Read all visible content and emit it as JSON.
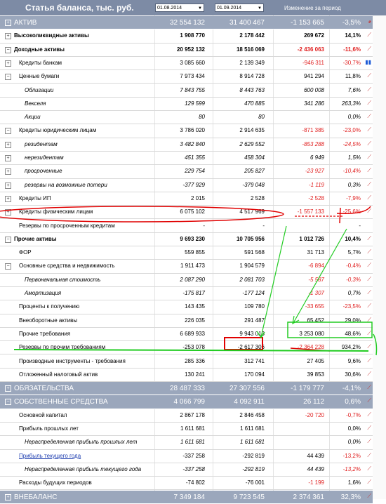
{
  "header": {
    "title": "Статья баланса, тыс. руб.",
    "date1": "01.08.2014",
    "date2": "01.09.2014",
    "change": "Изменение за период"
  },
  "rows": [
    {
      "label": "АКТИВ",
      "v1": "32 554 132",
      "v2": "31 400 467",
      "v3": "-1 153 665",
      "v4": "-3,5%",
      "style": "band",
      "exp": "+",
      "icon": "pie",
      "indent": 0
    },
    {
      "label": "Высоколиквидные активы",
      "v1": "1 908 770",
      "v2": "2 178 442",
      "v3": "269 672",
      "v4": "14,1%",
      "style": "bold",
      "exp": "+",
      "icon": "trend",
      "indent": 0
    },
    {
      "label": "Доходные активы",
      "v1": "20 952 132",
      "v2": "18 516 069",
      "v3": "-2 436 063",
      "v4": "-11,6%",
      "style": "bold",
      "exp": "-",
      "icon": "trend",
      "indent": 0
    },
    {
      "label": "Кредиты банкам",
      "v1": "3 085 660",
      "v2": "2 139 349",
      "v3": "-946 311",
      "v4": "-30,7%",
      "style": "",
      "exp": "+",
      "icon": "bars",
      "indent": 1
    },
    {
      "label": "Ценные бумаги",
      "v1": "7 973 434",
      "v2": "8 914 728",
      "v3": "941 294",
      "v4": "11,8%",
      "style": "",
      "exp": "-",
      "icon": "trend",
      "indent": 1
    },
    {
      "label": "Облигации",
      "v1": "7 843 755",
      "v2": "8 443 763",
      "v3": "600 008",
      "v4": "7,6%",
      "style": "italic",
      "exp": "",
      "icon": "trend",
      "indent": 2
    },
    {
      "label": "Векселя",
      "v1": "129 599",
      "v2": "470 885",
      "v3": "341 286",
      "v4": "263,3%",
      "style": "italic",
      "exp": "",
      "icon": "trend",
      "indent": 2
    },
    {
      "label": "Акции",
      "v1": "80",
      "v2": "80",
      "v3": "",
      "v4": "0,0%",
      "style": "italic",
      "exp": "",
      "icon": "trend",
      "indent": 2
    },
    {
      "label": "Кредиты юридическим лицам",
      "v1": "3 786 020",
      "v2": "2 914 635",
      "v3": "-871 385",
      "v4": "-23,0%",
      "style": "",
      "exp": "-",
      "icon": "trend",
      "indent": 1
    },
    {
      "label": "резидентам",
      "v1": "3 482 840",
      "v2": "2 629 552",
      "v3": "-853 288",
      "v4": "-24,5%",
      "style": "italic",
      "exp": "+",
      "icon": "trend",
      "indent": 2
    },
    {
      "label": "нерезидентам",
      "v1": "451 355",
      "v2": "458 304",
      "v3": "6 949",
      "v4": "1,5%",
      "style": "italic",
      "exp": "+",
      "icon": "trend",
      "indent": 2
    },
    {
      "label": "просроченные",
      "v1": "229 754",
      "v2": "205 827",
      "v3": "-23 927",
      "v4": "-10,4%",
      "style": "italic",
      "exp": "+",
      "icon": "trend",
      "indent": 2
    },
    {
      "label": "резервы на возможные потери",
      "v1": "-377 929",
      "v2": "-379 048",
      "v3": "-1 119",
      "v4": "0,3%",
      "style": "italic",
      "exp": "+",
      "icon": "trend",
      "indent": 2
    },
    {
      "label": "Кредиты ИП",
      "v1": "2 015",
      "v2": "2 528",
      "v3": "-2 528",
      "v4": "-7,9%",
      "style": "",
      "exp": "+",
      "icon": "trend",
      "indent": 1
    },
    {
      "label": "Кредиты физическим лицам",
      "v1": "6 075 102",
      "v2": "4 517 969",
      "v3": "-1 557 133",
      "v4": "-25,6%",
      "style": "",
      "exp": "+",
      "icon": "trend",
      "indent": 1
    },
    {
      "label": "Резервы по просроченным кредитам",
      "v1": "-",
      "v2": "-",
      "v3": "",
      "v4": "-",
      "style": "",
      "exp": "",
      "icon": "",
      "indent": 1
    },
    {
      "label": "Прочие активы",
      "v1": "9 693 230",
      "v2": "10 705 956",
      "v3": "1 012 726",
      "v4": "10,4%",
      "style": "bold",
      "exp": "-",
      "icon": "trend",
      "indent": 0
    },
    {
      "label": "ФОР",
      "v1": "559 855",
      "v2": "591 568",
      "v3": "31 713",
      "v4": "5,7%",
      "style": "",
      "exp": "",
      "icon": "trend",
      "indent": 1
    },
    {
      "label": "Основные средства и недвижимость",
      "v1": "1 911 473",
      "v2": "1 904 579",
      "v3": "-6 894",
      "v4": "-0,4%",
      "style": "",
      "exp": "-",
      "icon": "trend",
      "indent": 1
    },
    {
      "label": "Первоначальная стоимость",
      "v1": "2 087 290",
      "v2": "2 081 703",
      "v3": "-5 587",
      "v4": "-0,3%",
      "style": "italic",
      "exp": "",
      "icon": "trend",
      "indent": 2
    },
    {
      "label": "Амортизация",
      "v1": "-175 817",
      "v2": "-177 124",
      "v3": "-1 307",
      "v4": "0,7%",
      "style": "italic",
      "exp": "",
      "icon": "trend",
      "indent": 2
    },
    {
      "label": "Проценты к получению",
      "v1": "143 435",
      "v2": "109 780",
      "v3": "-33 655",
      "v4": "-23,5%",
      "style": "",
      "exp": "",
      "icon": "trend",
      "indent": 1
    },
    {
      "label": "Внеоборотные активы",
      "v1": "226 035",
      "v2": "291 487",
      "v3": "65 452",
      "v4": "29,0%",
      "style": "",
      "exp": "",
      "icon": "trend",
      "indent": 1
    },
    {
      "label": "Прочие требования",
      "v1": "6 689 933",
      "v2": "9 943 013",
      "v3": "3 253 080",
      "v4": "48,6%",
      "style": "",
      "exp": "",
      "icon": "trend",
      "indent": 1
    },
    {
      "label": "Резервы по прочим требованиям",
      "v1": "-253 078",
      "v2": "-2 617 306",
      "v3": "-2 364 228",
      "v4": "934,2%",
      "style": "",
      "exp": "",
      "icon": "trend",
      "indent": 1
    },
    {
      "label": "Производные инструменты - требования",
      "v1": "285 336",
      "v2": "312 741",
      "v3": "27 405",
      "v4": "9,6%",
      "style": "",
      "exp": "",
      "icon": "trend",
      "indent": 1
    },
    {
      "label": "Отложенный налоговый актив",
      "v1": "130 241",
      "v2": "170 094",
      "v3": "39 853",
      "v4": "30,6%",
      "style": "",
      "exp": "",
      "icon": "trend",
      "indent": 1
    },
    {
      "label": "ОБЯЗАТЕЛЬСТВА",
      "v1": "28 487 333",
      "v2": "27 307 556",
      "v3": "-1 179 777",
      "v4": "-4,1%",
      "style": "band",
      "exp": "+",
      "icon": "trend",
      "indent": 0
    },
    {
      "label": "СОБСТВЕННЫЕ СРЕДСТВА",
      "v1": "4 066 799",
      "v2": "4 092 911",
      "v3": "26 112",
      "v4": "0,6%",
      "style": "band",
      "exp": "-",
      "icon": "trend",
      "indent": 0
    },
    {
      "label": "Основной капитал",
      "v1": "2 867 178",
      "v2": "2 846 458",
      "v3": "-20 720",
      "v4": "-0,7%",
      "style": "",
      "exp": "",
      "icon": "trend",
      "indent": 1
    },
    {
      "label": "Прибыль прошлых лет",
      "v1": "1 611 681",
      "v2": "1 611 681",
      "v3": "",
      "v4": "0,0%",
      "style": "",
      "exp": "",
      "icon": "trend",
      "indent": 1
    },
    {
      "label": "Нераспределенная прибыль прошлых лет",
      "v1": "1 611 681",
      "v2": "1 611 681",
      "v3": "",
      "v4": "0,0%",
      "style": "italic",
      "exp": "",
      "icon": "trend",
      "indent": 2
    },
    {
      "label": "Прибыль текущего года",
      "v1": "-337 258",
      "v2": "-292 819",
      "v3": "44 439",
      "v4": "-13,2%",
      "style": "link",
      "exp": "",
      "icon": "trend",
      "indent": 1
    },
    {
      "label": "Нераспределенная прибыль текущего года",
      "v1": "-337 258",
      "v2": "-292 819",
      "v3": "44 439",
      "v4": "-13,2%",
      "style": "italic",
      "exp": "",
      "icon": "trend",
      "indent": 2
    },
    {
      "label": "Расходы будущих периодов",
      "v1": "-74 802",
      "v2": "-76 001",
      "v3": "-1 199",
      "v4": "1,6%",
      "style": "",
      "exp": "",
      "icon": "trend",
      "indent": 1
    },
    {
      "label": "ВНЕБАЛАНС",
      "v1": "7 349 184",
      "v2": "9 723 545",
      "v3": "2 374 361",
      "v4": "32,3%",
      "style": "band",
      "exp": "+",
      "icon": "trend",
      "indent": 0
    }
  ],
  "colors": {
    "band": "#9ba7bc",
    "header": "#7d8ba5",
    "negative": "#e02020",
    "highlight_red": "#e00000",
    "highlight_green": "#22cc22"
  },
  "icons": {
    "trend": "trend-chart-icon",
    "bars": "bar-chart-icon",
    "pie": "pie-chart-icon"
  }
}
